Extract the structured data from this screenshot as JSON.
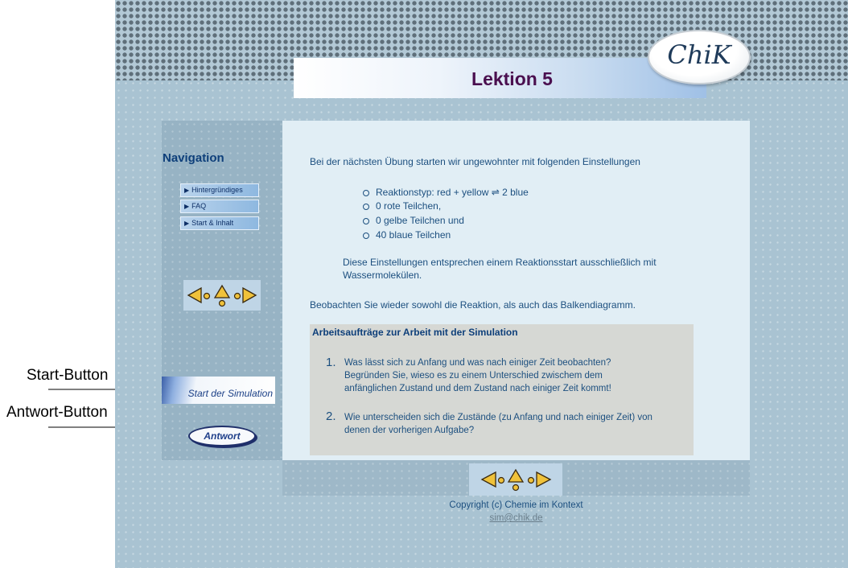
{
  "annotations": {
    "start_label": "Start-Button",
    "answer_label": "Antwort-Button"
  },
  "header": {
    "title": "Lektion 5",
    "logo_text": "ChiK"
  },
  "navigation": {
    "heading": "Navigation",
    "items": [
      {
        "label": "Hintergründiges"
      },
      {
        "label": "FAQ"
      },
      {
        "label": "Start & Inhalt"
      }
    ],
    "start_button": "Start der Simulation",
    "answer_button": "Antwort"
  },
  "content": {
    "intro": "Bei der nächsten Übung starten wir ungewohnter mit folgenden Einstellungen",
    "settings": [
      "Reaktionstyp: red + yellow ⇌ 2 blue",
      "0 rote Teilchen,",
      "0 gelbe Teilchen und",
      "40 blaue Teilchen"
    ],
    "note_line1": "Diese Einstellungen entsprechen einem Reaktionsstart ausschließlich mit",
    "note_line2": "Wassermolekülen.",
    "observe": "Beobachten Sie wieder sowohl die Reaktion, als auch das Balkendiagramm.",
    "tasks_heading": "Arbeitsaufträge zur Arbeit mit der Simulation",
    "tasks": [
      {
        "num": "1.",
        "lines": [
          "Was lässt sich zu Anfang und was nach einiger Zeit beobachten?",
          "Begründen Sie, wieso es zu einem Unterschied zwischem dem",
          "anfänglichen Zustand und dem Zustand nach einiger Zeit kommt!"
        ]
      },
      {
        "num": "2.",
        "lines": [
          "Wie unterscheiden sich die Zustände (zu Anfang und nach einiger Zeit) von",
          "denen der vorherigen Aufgabe?"
        ]
      }
    ]
  },
  "footer": {
    "copyright": "Copyright (c) Chemie im Kontext",
    "email": "sim@chik.de"
  },
  "icons": {
    "prev": "arrow-left-icon",
    "up": "arrow-up-icon",
    "next": "arrow-right-icon"
  },
  "colors": {
    "title": "#4a0f4f",
    "text": "#1c4f7f",
    "arrow_fill": "#f0c23a"
  }
}
